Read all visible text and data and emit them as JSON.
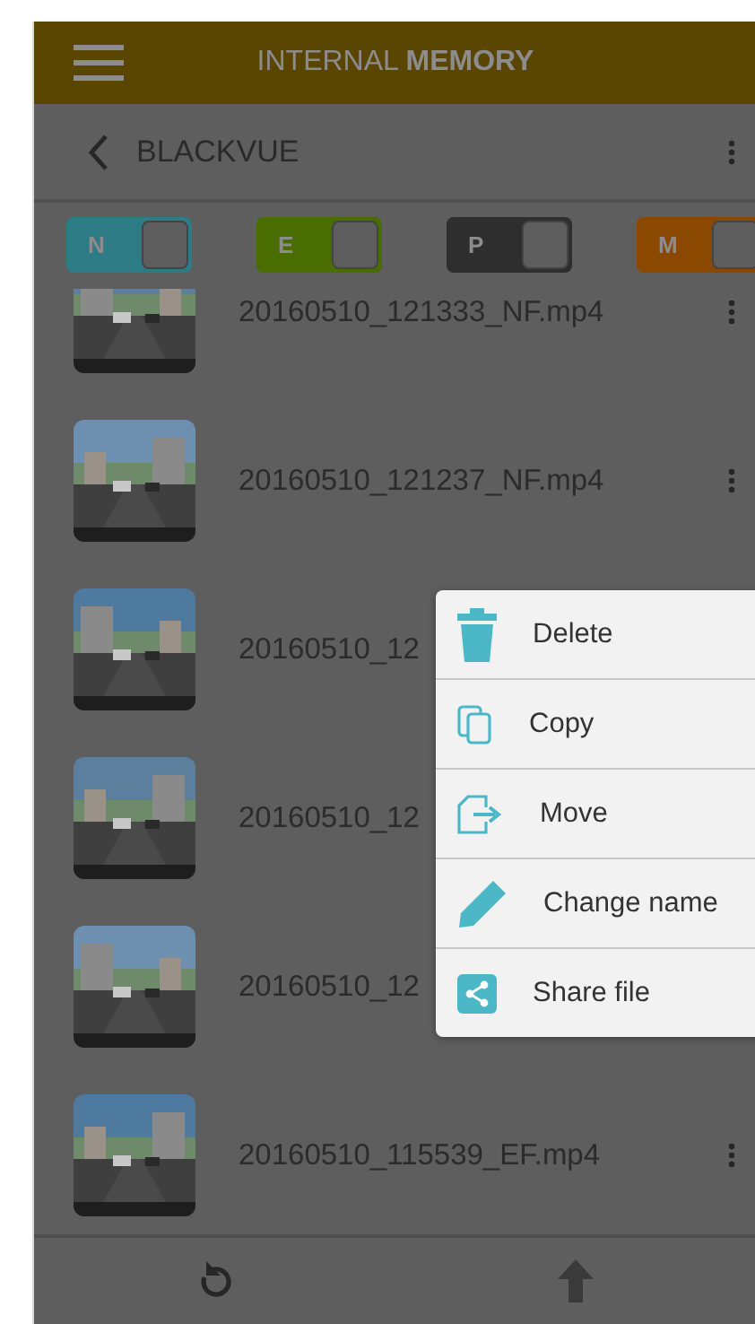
{
  "header": {
    "title": "INTERNAL **MEMORY**"
  },
  "folder": {
    "name": "BLACKVUE"
  },
  "filters": [
    {
      "label": "N",
      "color": "#2d7c85"
    },
    {
      "label": "E",
      "color": "#4a6d00"
    },
    {
      "label": "P",
      "color": "#2e2e2e"
    },
    {
      "label": "M",
      "color": "#8a4800"
    }
  ],
  "files": [
    {
      "name": "20160510_121333_NF.mp4",
      "menu": true
    },
    {
      "name": "20160510_121237_NF.mp4",
      "menu": true
    },
    {
      "name": "20160510_12",
      "menu": false
    },
    {
      "name": "20160510_12",
      "menu": false
    },
    {
      "name": "20160510_12",
      "menu": false
    },
    {
      "name": "20160510_115539_EF.mp4",
      "menu": true
    }
  ],
  "context_menu": [
    {
      "label": "Delete",
      "kind": "delete"
    },
    {
      "label": "Copy",
      "kind": "copy"
    },
    {
      "label": "Move",
      "kind": "move"
    },
    {
      "label": "Change name",
      "kind": "rename"
    },
    {
      "label": "Share file",
      "kind": "share"
    }
  ]
}
